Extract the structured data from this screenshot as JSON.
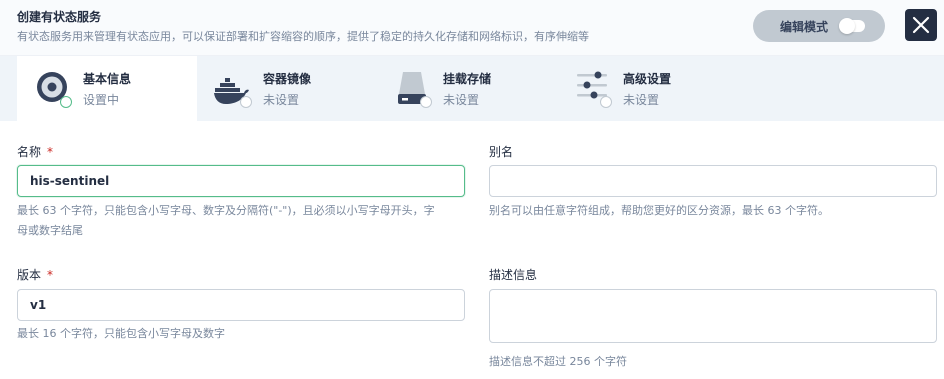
{
  "header": {
    "title": "创建有状态服务",
    "description": "有状态服务用来管理有状态应用，可以保证部署和扩容缩容的顺序，提供了稳定的持久化存储和网络标识，有序伸缩等",
    "edit_mode_label": "编辑模式"
  },
  "steps": [
    {
      "title": "基本信息",
      "status": "设置中",
      "icon": "basic-info-icon"
    },
    {
      "title": "容器镜像",
      "status": "未设置",
      "icon": "docker-icon"
    },
    {
      "title": "挂载存储",
      "status": "未设置",
      "icon": "storage-icon"
    },
    {
      "title": "高级设置",
      "status": "未设置",
      "icon": "advanced-settings-icon"
    }
  ],
  "form": {
    "name": {
      "label": "名称",
      "required_mark": "*",
      "value": "his-sentinel",
      "help_line1": "最长 63 个字符，只能包含小写字母、数字及分隔符(\"-\")，且必须以小写字母开头，字",
      "help_line2": "母或数字结尾"
    },
    "alias": {
      "label": "别名",
      "value": "",
      "help": "别名可以由任意字符组成，帮助您更好的区分资源，最长 63 个字符。"
    },
    "version": {
      "label": "版本",
      "required_mark": "*",
      "value": "v1",
      "help": "最长 16 个字符，只能包含小写字母及数字"
    },
    "description": {
      "label": "描述信息",
      "value": "",
      "help": "描述信息不超过 256 个字符"
    }
  },
  "colors": {
    "primary_dark": "#242e42",
    "success_green": "#55bc8a",
    "required_red": "#ca2621",
    "muted_text": "#79879c",
    "steps_bg": "#eff4f9"
  }
}
